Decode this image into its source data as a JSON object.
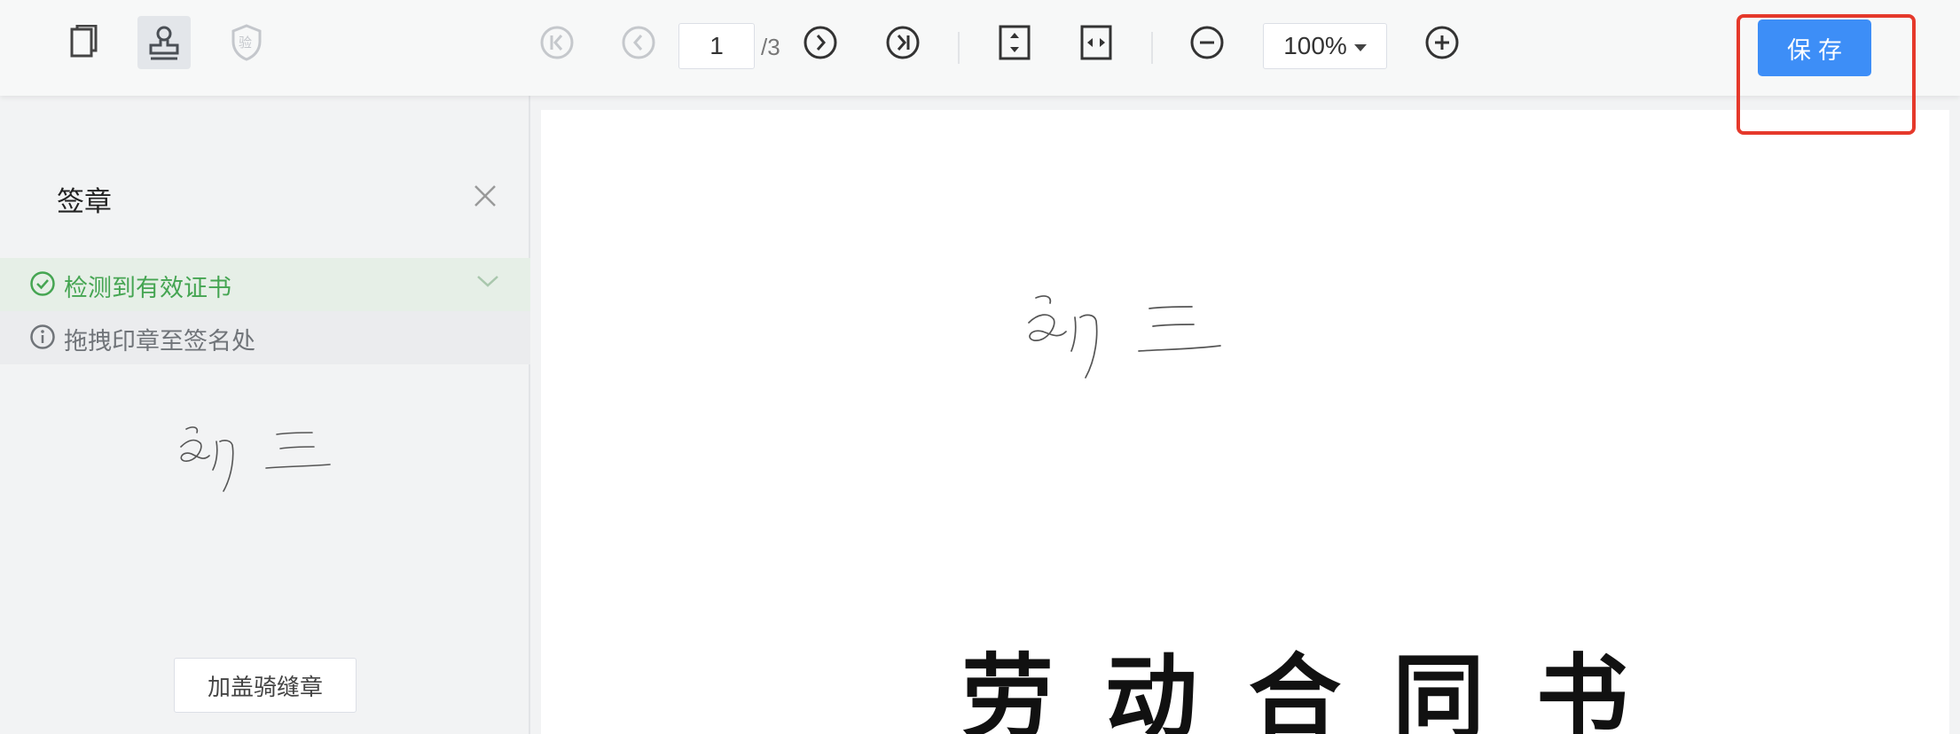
{
  "toolbar": {
    "mode_buttons": [
      {
        "icon": "copy-pages-icon",
        "active": false
      },
      {
        "icon": "stamp-icon",
        "active": true
      },
      {
        "icon": "verify-shield-icon",
        "label": "验",
        "active": false
      }
    ],
    "nav": {
      "first_icon": "first-page-icon",
      "prev_icon": "prev-page-icon",
      "next_icon": "next-page-icon",
      "last_icon": "last-page-icon"
    },
    "page_current": "1",
    "page_total": "/3",
    "fit_height_icon": "fit-height-icon",
    "fit_width_icon": "fit-width-icon",
    "zoom_out_icon": "zoom-out-icon",
    "zoom_value": "100%",
    "zoom_in_icon": "zoom-in-icon",
    "save_label": "保存"
  },
  "sidebar": {
    "title": "签章",
    "close_icon": "close-icon",
    "cert_status": "检测到有效证书",
    "hint": "拖拽印章至签名处",
    "signature_thumb": "handwritten-signature",
    "riding_seal_label": "加盖骑缝章"
  },
  "document": {
    "title": "劳动合同书",
    "signature": "handwritten-signature"
  },
  "colors": {
    "accent": "#3d8ef7",
    "success": "#45a552",
    "highlight": "#e5392b"
  }
}
